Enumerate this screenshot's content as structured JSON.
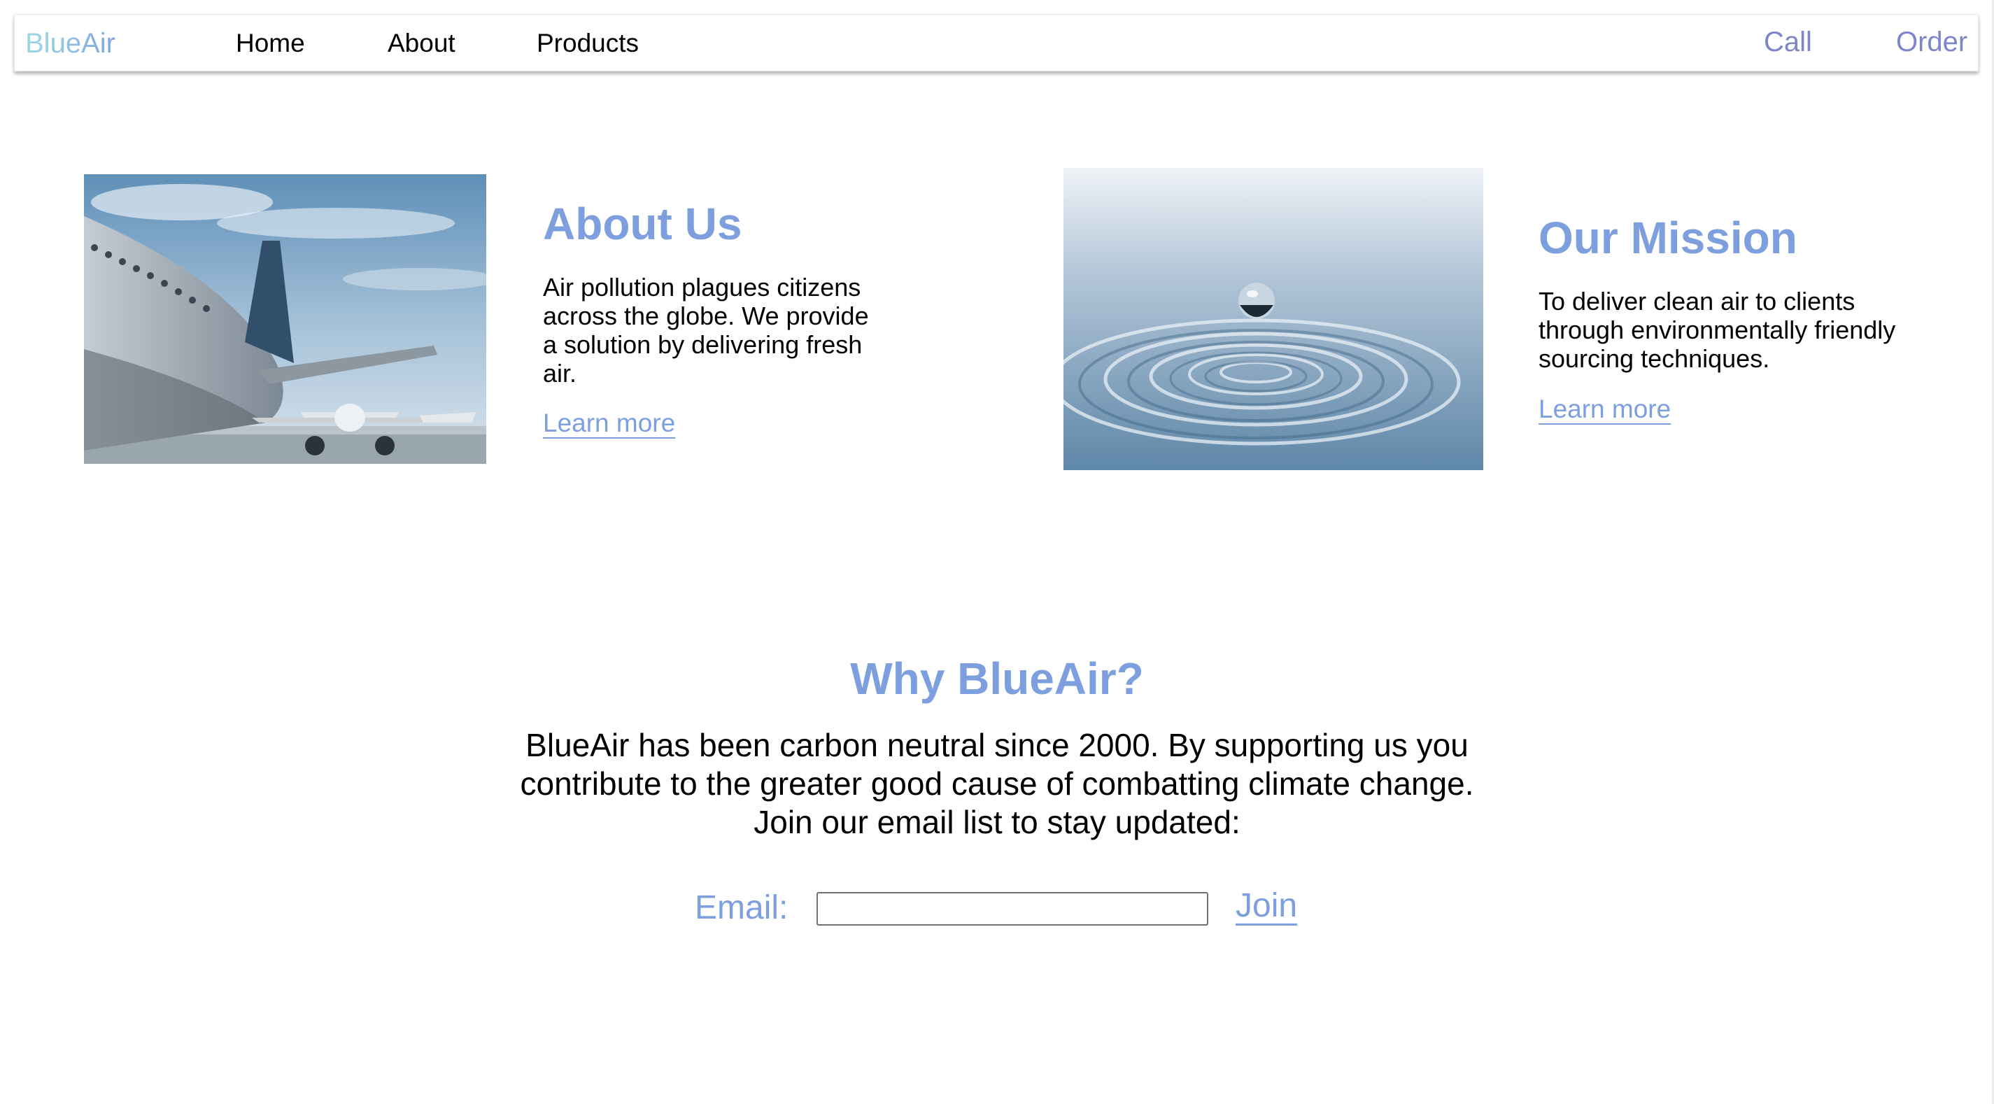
{
  "nav": {
    "logo": "BlueAir",
    "links": [
      "Home",
      "About",
      "Products"
    ],
    "right": [
      "Call",
      "Order"
    ]
  },
  "features": [
    {
      "title": "About Us",
      "text": "Air pollution plagues citizens across the globe. We provide a solution by delivering fresh air.",
      "link": "Learn more",
      "image": "airplane-photo"
    },
    {
      "title": "Our Mission",
      "text": "To deliver clean air to clients through environmentally friendly sourcing techniques.",
      "link": "Learn more",
      "image": "water-drop-photo"
    }
  ],
  "why": {
    "title": "Why BlueAir?",
    "text": "BlueAir has been carbon neutral since 2000. By supporting us you contribute to the greater good cause of combatting climate change. Join our email list to stay updated:",
    "email_label": "Email:",
    "email_value": "",
    "join_label": "Join"
  },
  "colors": {
    "accent": "#7e9fde",
    "nav_right": "#7c86c8",
    "logo_start": "#9ed9e6"
  }
}
